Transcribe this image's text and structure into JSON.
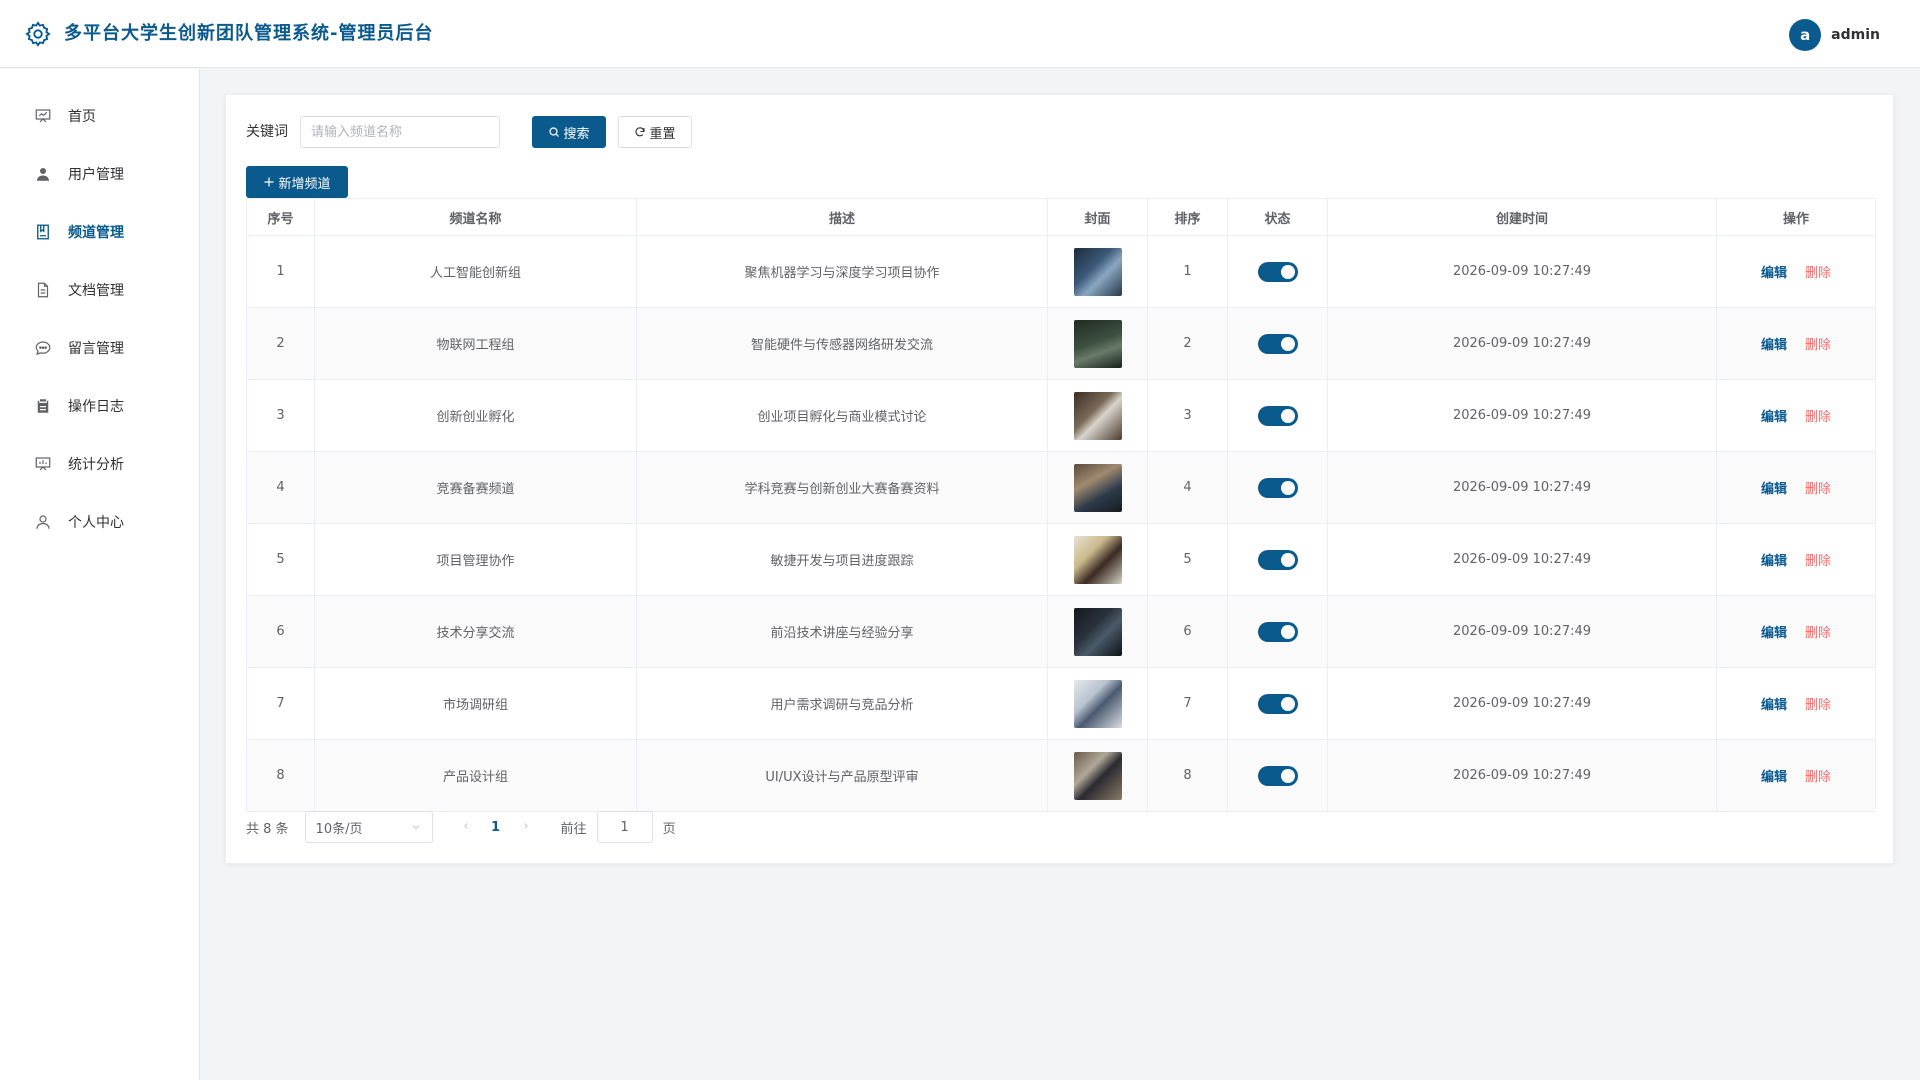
{
  "header": {
    "title": "多平台大学生创新团队管理系统-管理员后台",
    "avatar_letter": "a",
    "username": "admin"
  },
  "sidebar": {
    "items": [
      {
        "label": "首页",
        "icon": "presentation-icon"
      },
      {
        "label": "用户管理",
        "icon": "user-icon"
      },
      {
        "label": "频道管理",
        "icon": "notebook-icon",
        "active": true
      },
      {
        "label": "文档管理",
        "icon": "document-icon"
      },
      {
        "label": "留言管理",
        "icon": "chat-bubble-icon"
      },
      {
        "label": "操作日志",
        "icon": "clipboard-icon"
      },
      {
        "label": "统计分析",
        "icon": "chart-board-icon"
      },
      {
        "label": "个人中心",
        "icon": "user-outline-icon"
      }
    ]
  },
  "search": {
    "label": "关键词",
    "placeholder": "请输入频道名称",
    "value": "",
    "search_button": "搜索",
    "reset_button": "重置"
  },
  "add_button": "新增频道",
  "table": {
    "headers": [
      "序号",
      "频道名称",
      "描述",
      "封面",
      "排序",
      "状态",
      "创建时间",
      "操作"
    ],
    "edit_label": "编辑",
    "delete_label": "删除",
    "rows": [
      {
        "index": "1",
        "name": "人工智能创新组",
        "desc": "聚焦机器学习与深度学习项目协作",
        "sort": "1",
        "enabled": true,
        "created": "2026-09-09 10:27:49"
      },
      {
        "index": "2",
        "name": "物联网工程组",
        "desc": "智能硬件与传感器网络研发交流",
        "sort": "2",
        "enabled": true,
        "created": "2026-09-09 10:27:49"
      },
      {
        "index": "3",
        "name": "创新创业孵化",
        "desc": "创业项目孵化与商业模式讨论",
        "sort": "3",
        "enabled": true,
        "created": "2026-09-09 10:27:49"
      },
      {
        "index": "4",
        "name": "竞赛备赛频道",
        "desc": "学科竞赛与创新创业大赛备赛资料",
        "sort": "4",
        "enabled": true,
        "created": "2026-09-09 10:27:49"
      },
      {
        "index": "5",
        "name": "项目管理协作",
        "desc": "敏捷开发与项目进度跟踪",
        "sort": "5",
        "enabled": true,
        "created": "2026-09-09 10:27:49"
      },
      {
        "index": "6",
        "name": "技术分享交流",
        "desc": "前沿技术讲座与经验分享",
        "sort": "6",
        "enabled": true,
        "created": "2026-09-09 10:27:49"
      },
      {
        "index": "7",
        "name": "市场调研组",
        "desc": "用户需求调研与竞品分析",
        "sort": "7",
        "enabled": true,
        "created": "2026-09-09 10:27:49"
      },
      {
        "index": "8",
        "name": "产品设计组",
        "desc": "UI/UX设计与产品原型评审",
        "sort": "8",
        "enabled": true,
        "created": "2026-09-09 10:27:49"
      }
    ]
  },
  "pagination": {
    "total": "共 8 条",
    "page_size": "10条/页",
    "current_page": "1",
    "goto_label": "前往",
    "goto_value": "1",
    "page_suffix": "页"
  },
  "colors": {
    "primary": "#0b5a8e",
    "danger": "#f56c6c"
  }
}
